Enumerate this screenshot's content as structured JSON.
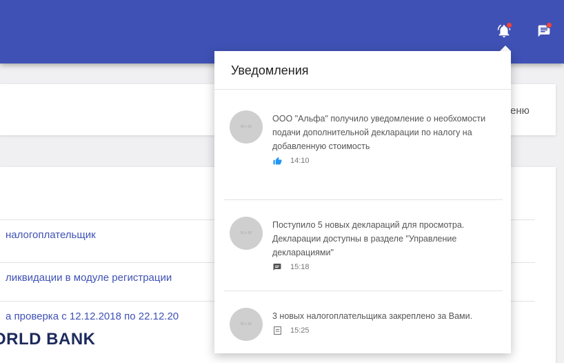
{
  "header": {
    "bell_icon": "bell-notification-icon",
    "chat_icon": "chat-message-icon",
    "accent": "#3f51b5",
    "badge_color": "#f44336"
  },
  "background": {
    "card1_text": "еню",
    "rows": [
      "налогоплательщик",
      "ликвидации в модуле регистрации",
      "а проверка с 12.12.2018 по 22.12.20"
    ],
    "logo_text": "ORLD BANK"
  },
  "notifications": {
    "title": "Уведомления",
    "items": [
      {
        "avatar_text": "90 x 90",
        "message": "ООО \"Альфа\" получило уведомление о необхомости подачи дополнительной декларации по налогу на добавленную стоимость",
        "icon": "thumbs-up-icon",
        "time": "14:10"
      },
      {
        "avatar_text": "90 x 90",
        "message": "Поступило 5 новых деклараций для просмотра. Декларации доступны в разделе \"Управление декларациями\"",
        "icon": "comment-icon",
        "time": "15:18"
      },
      {
        "avatar_text": "90 x 90",
        "message": "3 новых налогоплательщика закреплено за Вами.",
        "icon": "document-icon",
        "time": "15:25"
      }
    ]
  }
}
